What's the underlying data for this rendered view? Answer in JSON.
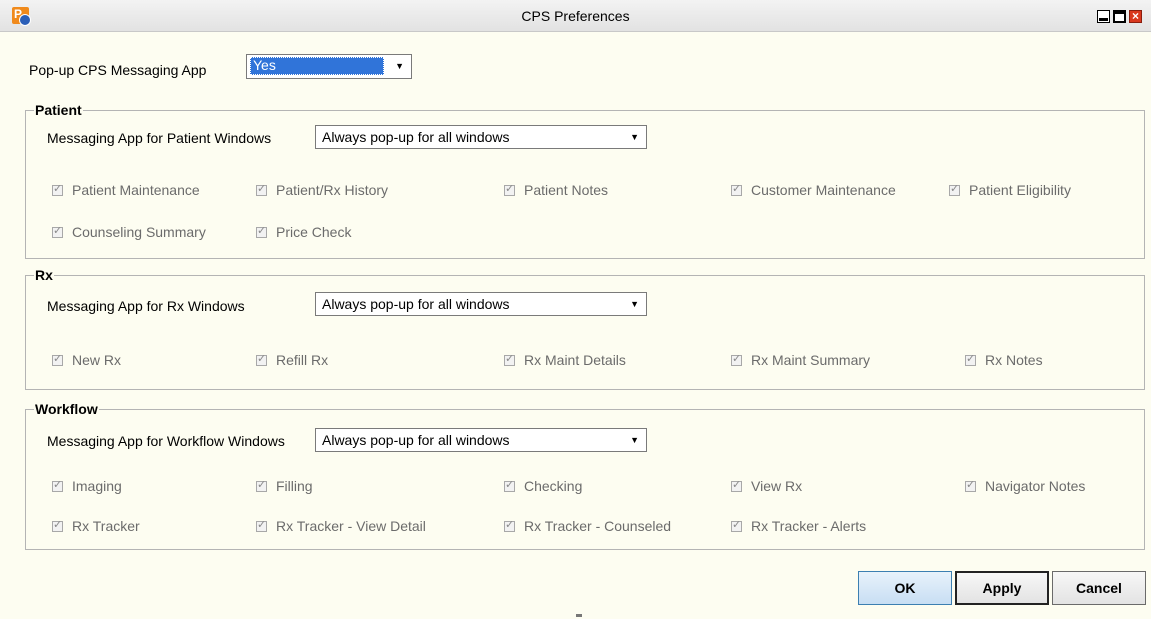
{
  "window": {
    "title": "CPS Preferences"
  },
  "popup": {
    "label": "Pop-up CPS Messaging App",
    "value": "Yes"
  },
  "patient": {
    "legend": "Patient",
    "label": "Messaging App for Patient Windows",
    "value": "Always pop-up for all windows",
    "items": [
      "Patient Maintenance",
      "Patient/Rx History",
      "Patient Notes",
      "Customer Maintenance",
      "Patient Eligibility",
      "Counseling Summary",
      "Price Check"
    ]
  },
  "rx": {
    "legend": "Rx",
    "label": "Messaging App for Rx Windows",
    "value": "Always pop-up for all windows",
    "items": [
      "New Rx",
      "Refill Rx",
      "Rx Maint Details",
      "Rx Maint Summary",
      "Rx Notes"
    ]
  },
  "workflow": {
    "legend": "Workflow",
    "label": "Messaging App for Workflow Windows",
    "value": "Always pop-up for all windows",
    "items": [
      "Imaging",
      "Filling",
      "Checking",
      "View Rx",
      "Navigator Notes",
      "Rx Tracker",
      "Rx Tracker - View Detail",
      "Rx Tracker - Counseled",
      "Rx Tracker - Alerts"
    ]
  },
  "buttons": {
    "ok": "OK",
    "apply": "Apply",
    "cancel": "Cancel"
  },
  "colors": {
    "background": "#fdfdf1",
    "selection": "#3074d9",
    "disabled_text": "#6b6b6b"
  }
}
